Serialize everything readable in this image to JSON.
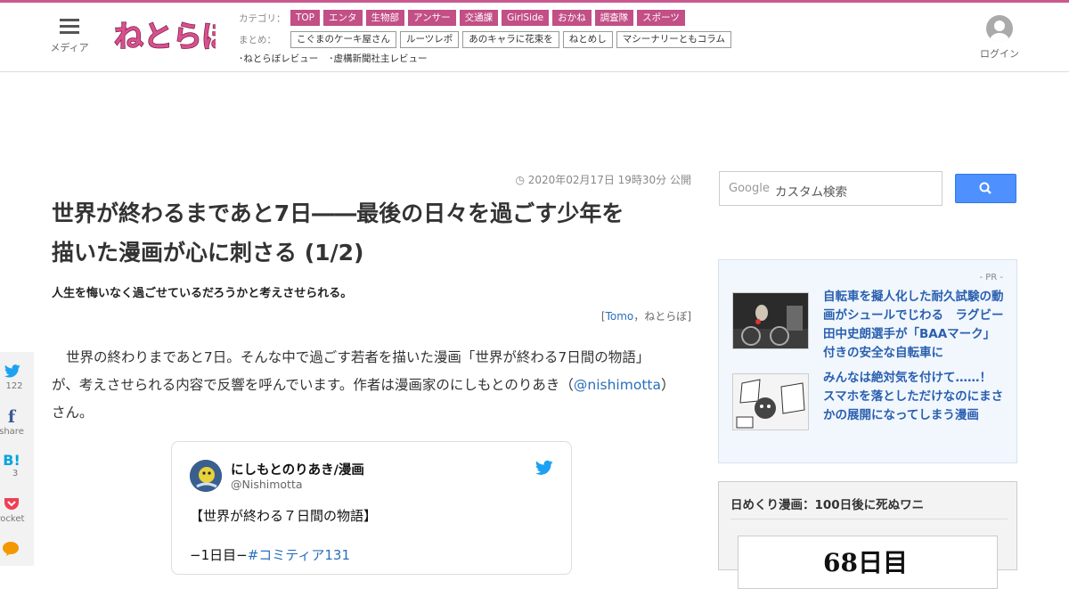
{
  "colors": {
    "brand": "#c85a8f",
    "tag_bg": "#c24f86",
    "link": "#2a6ebb"
  },
  "header": {
    "menu_label": "メディア",
    "logo_text": "ねとらぼ",
    "category_label": "カテゴリ：",
    "categories": [
      "TOP",
      "エンタ",
      "生物部",
      "アンサー",
      "交通課",
      "GirlSide",
      "おかね",
      "調査隊",
      "スポーツ"
    ],
    "matome_label": "まとめ：",
    "matome": [
      "こぐまのケーキ屋さん",
      "ルーツレポ",
      "あのキャラに花束を",
      "ねとめし",
      "マシーナリーともコラム"
    ],
    "reviews": [
      "･ねとらぼレビュー",
      "･虚構新聞社主レビュー"
    ],
    "login_label": "ログイン"
  },
  "article": {
    "date": "2020年02月17日 19時30分 公開",
    "title_line1": "世界が終わるまであと7日――最後の日々を過ごす少年を",
    "title_line2": "描いた漫画が心に刺さる (1/2)",
    "subtitle": "人生を悔いなく過ごせているだろうかと考えさせられる。",
    "author_open": "[",
    "author_name": "Tomo",
    "author_sep": "，",
    "author_site": "ねとらぼ",
    "author_close": "]",
    "body_line1": "世界の終わりまであと7日。そんな中で過ごす若者を描いた漫画「世界が終わる7日間の物語」",
    "body_line2_a": "が、考えさせられる内容で反響を呼んでいます。作者は漫画家のにしもとのりあき（",
    "body_handle": "@nishimotta",
    "body_line2_b": "）",
    "body_line3": "さん。"
  },
  "tweet": {
    "name": "にしもとのりあき/漫画",
    "handle": "@Nishimotta",
    "line1": "【世界が終わる７日間の物語】",
    "line2_prefix": "−1日目−",
    "line2_tag": "#コミティア131"
  },
  "share": {
    "twitter_count": "122",
    "facebook_label": "share",
    "hatena_count": "3",
    "pocket_label": "Pocket"
  },
  "sidebar": {
    "search_logo": "Google",
    "search_placeholder": "カスタム検索",
    "pr_label": "- PR -",
    "pr_items": [
      {
        "text": "自転車を擬人化した耐久試験の動画がシュールでじわる　ラグビー田中史朗選手が「BAAマーク」付きの安全な自転車に"
      },
      {
        "text": "みんなは絶対気を付けて……！　スマホを落としただけなのにまさかの展開になってしまう漫画"
      }
    ],
    "manga_title": "日めくり漫画：100日後に死ぬワニ",
    "manga_day": "68日目"
  }
}
